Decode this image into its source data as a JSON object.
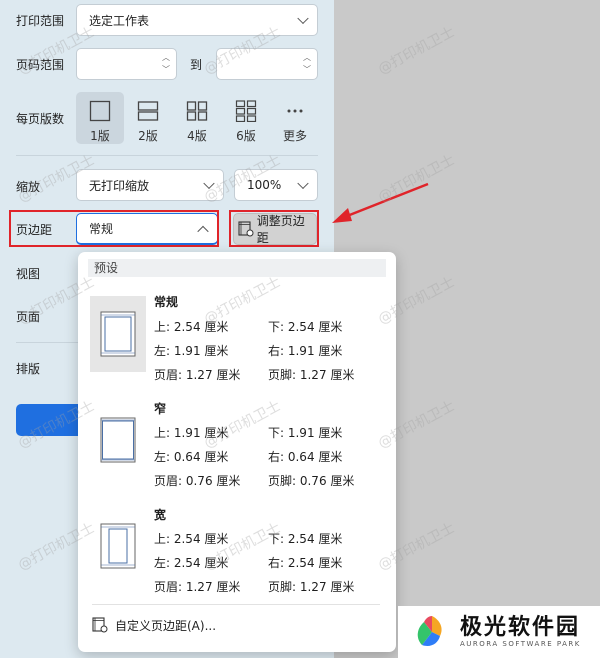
{
  "print_range": {
    "label": "打印范围",
    "value": "选定工作表"
  },
  "page_range": {
    "label": "页码范围",
    "to_label": "到"
  },
  "pages_per_sheet": {
    "label": "每页版数",
    "options": [
      "1版",
      "2版",
      "4版",
      "6版",
      "更多"
    ],
    "selected": "1版"
  },
  "scale": {
    "label": "缩放",
    "value": "无打印缩放",
    "zoom": "100%"
  },
  "margins": {
    "label": "页边距",
    "value": "常规",
    "adjust_label": "调整页边距"
  },
  "view": {
    "label": "视图"
  },
  "page": {
    "label": "页面"
  },
  "arrange": {
    "label": "排版"
  },
  "popup": {
    "header": "预设",
    "options": [
      {
        "title": "常规",
        "top": "上:  2.54 厘米",
        "bottom": "下:  2.54 厘米",
        "left": "左:  1.91 厘米",
        "right": "右:  1.91 厘米",
        "header": "页眉:  1.27 厘米",
        "footer": "页脚:  1.27 厘米"
      },
      {
        "title": "窄",
        "top": "上:  1.91 厘米",
        "bottom": "下:  1.91 厘米",
        "left": "左:  0.64 厘米",
        "right": "右:  0.64 厘米",
        "header": "页眉:  0.76 厘米",
        "footer": "页脚:  0.76 厘米"
      },
      {
        "title": "宽",
        "top": "上:  2.54 厘米",
        "bottom": "下:  2.54 厘米",
        "left": "左:  2.54 厘米",
        "right": "右:  2.54 厘米",
        "header": "页眉:  1.27 厘米",
        "footer": "页脚:  1.27 厘米"
      }
    ],
    "custom_label": "自定义页边距(A)..."
  },
  "watermark": "@打印机卫士",
  "brand": {
    "name": "极光软件园",
    "sub": "AURORA SOFTWARE PARK"
  },
  "colors": {
    "accent": "#1f6fe0",
    "highlight": "#e0242a",
    "panel": "#dde9f0"
  }
}
